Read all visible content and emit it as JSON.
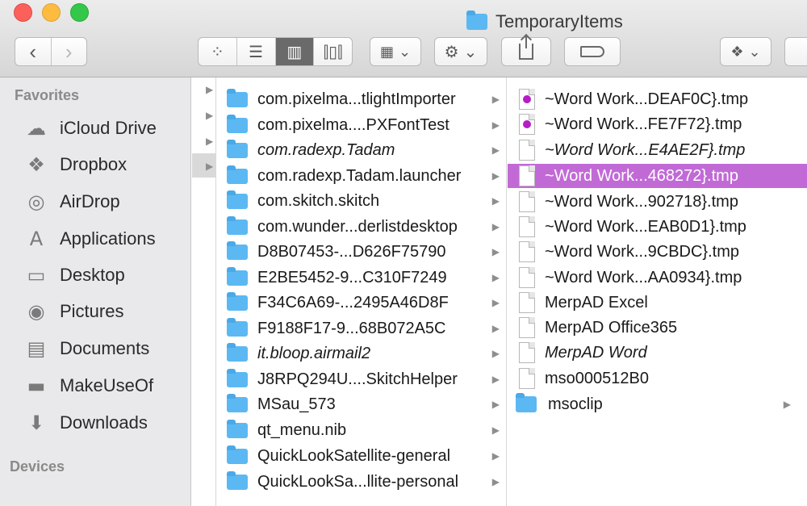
{
  "window": {
    "title": "TemporaryItems",
    "accent": "#c16ad6"
  },
  "toolbar": {
    "back_glyph": "‹",
    "forward_glyph": "›",
    "view_icons": [
      "icon-view",
      "list-view",
      "column-view",
      "cover-flow-view"
    ],
    "view_glyphs": [
      "⁘",
      "☰",
      "▥",
      "⫿▯⫿"
    ],
    "active_view": "column-view",
    "arrange_glyph": "▦",
    "action_glyph": "⚙",
    "dropdown_glyph": "⌄",
    "dropbox_glyph": "❖"
  },
  "sidebar": {
    "favorites_heading": "Favorites",
    "devices_heading": "Devices",
    "items": [
      {
        "label": "iCloud Drive",
        "icon": "cloud-icon",
        "glyph": "☁"
      },
      {
        "label": "Dropbox",
        "icon": "dropbox-icon",
        "glyph": "❖"
      },
      {
        "label": "AirDrop",
        "icon": "airdrop-icon",
        "glyph": "◎"
      },
      {
        "label": "Applications",
        "icon": "applications-icon",
        "glyph": "A"
      },
      {
        "label": "Desktop",
        "icon": "desktop-icon",
        "glyph": "▭"
      },
      {
        "label": "Pictures",
        "icon": "camera-icon",
        "glyph": "◉"
      },
      {
        "label": "Documents",
        "icon": "documents-icon",
        "glyph": "▤"
      },
      {
        "label": "MakeUseOf",
        "icon": "folder-icon",
        "glyph": "▬"
      },
      {
        "label": "Downloads",
        "icon": "downloads-icon",
        "glyph": "⬇"
      }
    ]
  },
  "column2": {
    "items": [
      {
        "label": "com.pixelma...tlightImporter",
        "italic": false
      },
      {
        "label": "com.pixelma....PXFontTest",
        "italic": false
      },
      {
        "label": "com.radexp.Tadam",
        "italic": true
      },
      {
        "label": "com.radexp.Tadam.launcher",
        "italic": false
      },
      {
        "label": "com.skitch.skitch",
        "italic": false
      },
      {
        "label": "com.wunder...derlistdesktop",
        "italic": false
      },
      {
        "label": "D8B07453-...D626F75790",
        "italic": false
      },
      {
        "label": "E2BE5452-9...C310F7249",
        "italic": false
      },
      {
        "label": "F34C6A69-...2495A46D8F",
        "italic": false
      },
      {
        "label": "F9188F17-9...68B072A5C",
        "italic": false
      },
      {
        "label": "it.bloop.airmail2",
        "italic": true
      },
      {
        "label": "J8RPQ294U....SkitchHelper",
        "italic": false
      },
      {
        "label": "MSau_573",
        "italic": false
      },
      {
        "label": "qt_menu.nib",
        "italic": false
      },
      {
        "label": "QuickLookSatellite-general",
        "italic": false
      },
      {
        "label": "QuickLookSa...llite-personal",
        "italic": false
      }
    ]
  },
  "column3": {
    "items": [
      {
        "label": "~Word Work...DEAF0C}.tmp",
        "icon": "purple",
        "italic": false
      },
      {
        "label": "~Word Work...FE7F72}.tmp",
        "icon": "purple",
        "italic": false
      },
      {
        "label": "~Word Work...E4AE2F}.tmp",
        "icon": "doc",
        "italic": true
      },
      {
        "label": "~Word Work...468272}.tmp",
        "icon": "doc",
        "italic": false,
        "selected": true
      },
      {
        "label": "~Word Work...902718}.tmp",
        "icon": "doc",
        "italic": false
      },
      {
        "label": "~Word Work...EAB0D1}.tmp",
        "icon": "doc",
        "italic": false
      },
      {
        "label": "~Word Work...9CBDC}.tmp",
        "icon": "doc",
        "italic": false
      },
      {
        "label": "~Word Work...AA0934}.tmp",
        "icon": "doc",
        "italic": false
      },
      {
        "label": "MerpAD Excel",
        "icon": "doc",
        "italic": false
      },
      {
        "label": "MerpAD Office365",
        "icon": "doc",
        "italic": false
      },
      {
        "label": "MerpAD Word",
        "icon": "doc",
        "italic": true
      },
      {
        "label": "mso000512B0",
        "icon": "doc",
        "italic": false
      },
      {
        "label": "msoclip",
        "icon": "folder",
        "italic": false
      }
    ]
  }
}
